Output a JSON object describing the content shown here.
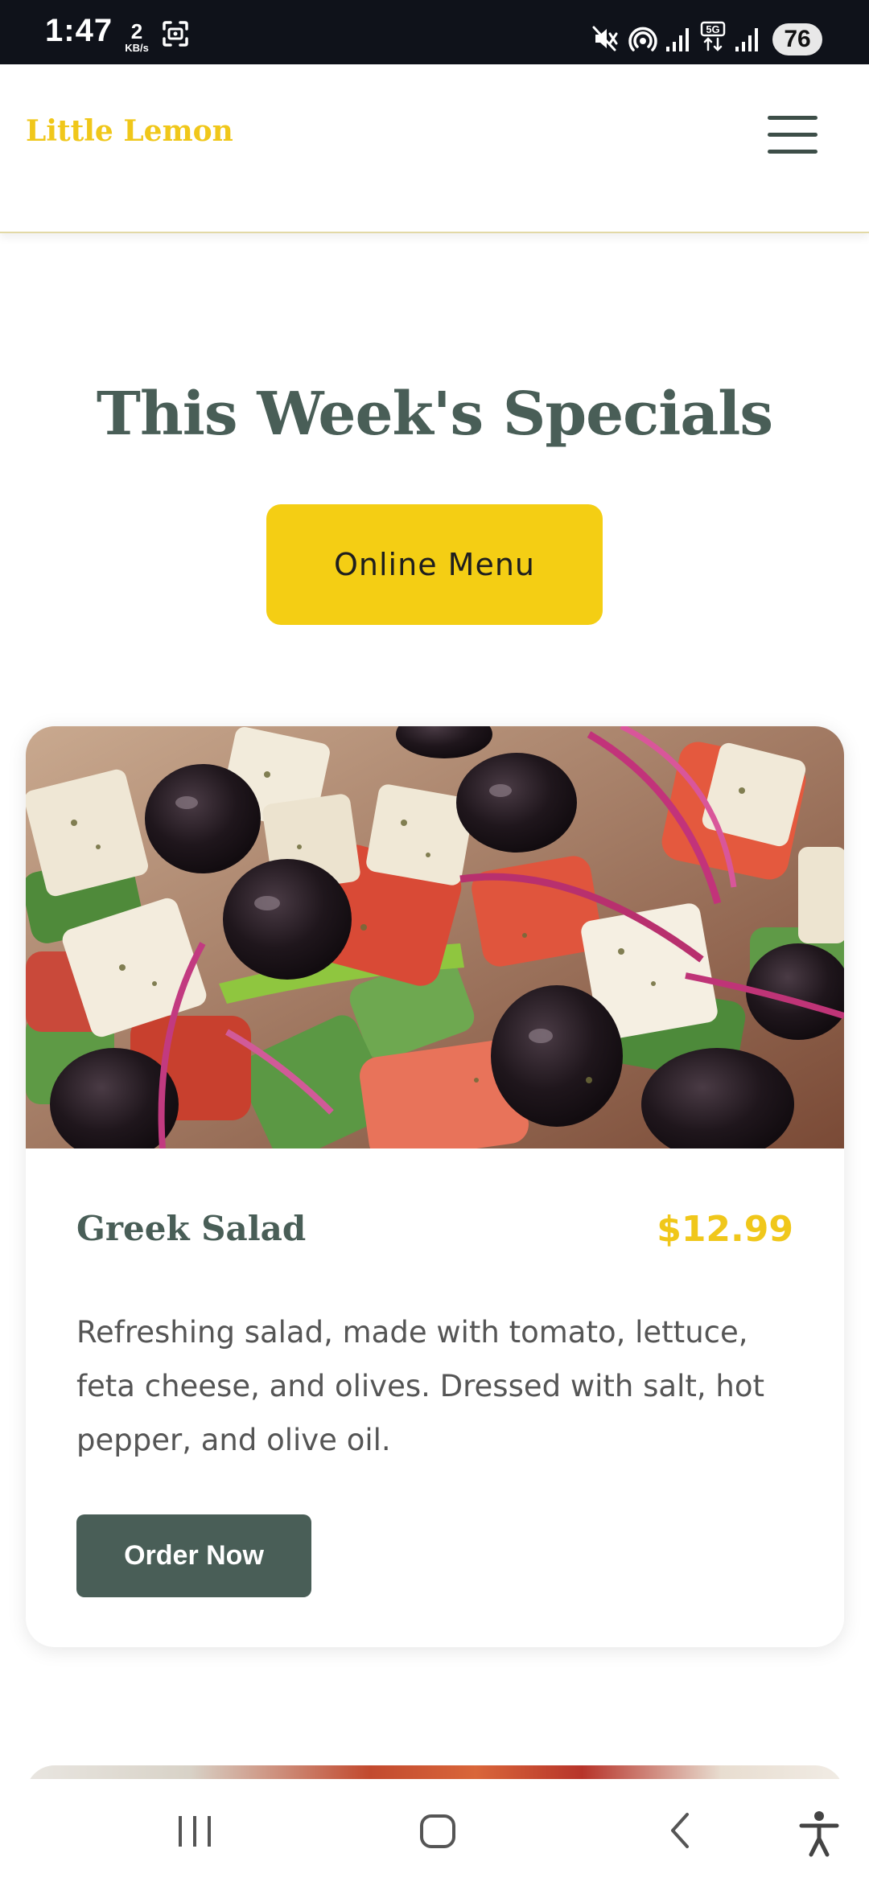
{
  "status_bar": {
    "time": "1:47",
    "network_speed_value": "2",
    "network_speed_unit": "KB/s",
    "battery": "76",
    "icons": [
      "screenshot-icon",
      "mute-icon",
      "hotspot-icon",
      "signal-icon",
      "5g-icon",
      "signal-icon"
    ]
  },
  "header": {
    "brand": "Little Lemon",
    "menu_icon": "hamburger-menu-icon"
  },
  "specials": {
    "title": "This Week's Specials",
    "online_menu_label": "Online Menu"
  },
  "card": {
    "image_alt": "Greek salad photo",
    "name": "Greek Salad",
    "price": "$12.99",
    "description": "Refreshing salad, made with tomato, lettuce, feta cheese, and olives. Dressed with salt, hot pepper, and olive oil.",
    "order_label": "Order Now"
  },
  "nav_bar": {
    "buttons": [
      "recent-apps-icon",
      "home-icon",
      "back-icon",
      "accessibility-icon"
    ]
  },
  "colors": {
    "brand_yellow": "#f4ce14",
    "brand_green": "#495e57",
    "status_bar_bg": "#0f121a"
  }
}
